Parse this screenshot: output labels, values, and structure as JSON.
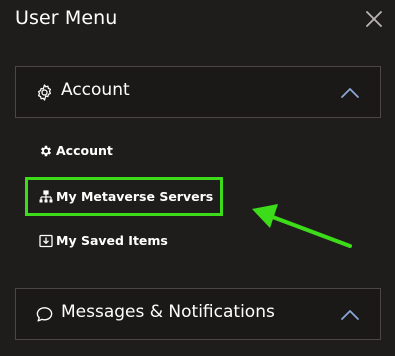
{
  "window": {
    "title": "User Menu"
  },
  "icons": {
    "close": "close-icon",
    "account_section": "gear-outline-icon",
    "account_item": "gear-icon",
    "servers_item": "sitemap-icon",
    "saved_item": "download-box-icon",
    "messages_section": "speech-bubble-icon",
    "chevron": "chevron-up-icon"
  },
  "sections": {
    "account": {
      "label": "Account",
      "items": [
        {
          "label": "Account"
        },
        {
          "label": "My Metaverse Servers"
        },
        {
          "label": "My Saved Items"
        }
      ]
    },
    "messages": {
      "label": "Messages & Notifications"
    }
  },
  "annotation": {
    "highlight_color": "#3ddc1a"
  },
  "colors": {
    "background": "#1f1d1b",
    "border": "#4a4744",
    "chevron": "#8aa6d6",
    "text": "#ffffff"
  }
}
